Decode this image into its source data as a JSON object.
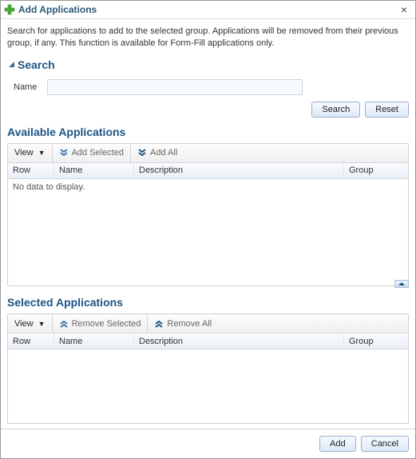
{
  "dialog": {
    "title": "Add Applications",
    "intro": "Search for applications to add to the selected group. Applications will be removed from their previous group, if any. This function is available for Form-Fill applications only."
  },
  "search": {
    "header": "Search",
    "name_label": "Name",
    "name_value": "",
    "search_btn": "Search",
    "reset_btn": "Reset"
  },
  "available": {
    "header": "Available Applications",
    "view_label": "View",
    "add_selected": "Add Selected",
    "add_all": "Add All",
    "cols": {
      "row": "Row",
      "name": "Name",
      "desc": "Description",
      "group": "Group"
    },
    "empty": "No data to display."
  },
  "selected": {
    "header": "Selected Applications",
    "view_label": "View",
    "remove_selected": "Remove Selected",
    "remove_all": "Remove All",
    "cols": {
      "row": "Row",
      "name": "Name",
      "desc": "Description",
      "group": "Group"
    }
  },
  "footer": {
    "add_btn": "Add",
    "cancel_btn": "Cancel"
  }
}
